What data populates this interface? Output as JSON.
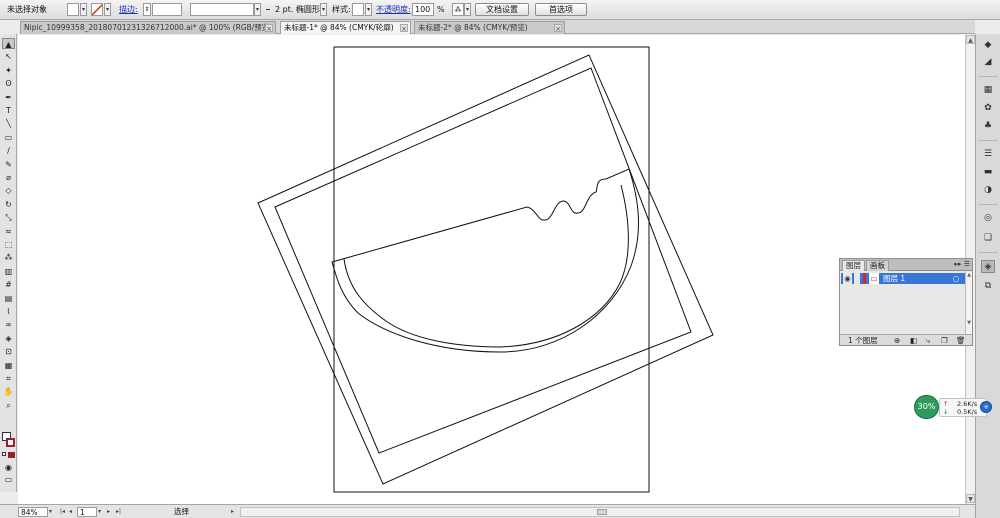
{
  "control_bar": {
    "selection_status": "未选择对象",
    "stroke_label": "描边:",
    "brush_label": "2 pt. 椭圆形",
    "style_label": "样式:",
    "opacity_label": "不透明度:",
    "opacity_value": "100",
    "opacity_unit": "%",
    "doc_setup_button": "文档设置",
    "preferences_button": "首选项"
  },
  "tabs": [
    {
      "label": "Nipic_10999358_20180701231326712000.ai* @ 100% (RGB/预览)",
      "active": false
    },
    {
      "label": "未标题-1* @ 84% (CMYK/轮廓)",
      "active": true
    },
    {
      "label": "未标题-2* @ 84% (CMYK/预览)",
      "active": false
    }
  ],
  "tools": [
    {
      "name": "selection-tool-icon",
      "glyph": "▲"
    },
    {
      "name": "direct-selection-tool-icon",
      "glyph": "↖"
    },
    {
      "name": "magic-wand-tool-icon",
      "glyph": "✦"
    },
    {
      "name": "lasso-tool-icon",
      "glyph": "ʘ"
    },
    {
      "name": "pen-tool-icon",
      "glyph": "✒"
    },
    {
      "name": "type-tool-icon",
      "glyph": "T"
    },
    {
      "name": "line-segment-tool-icon",
      "glyph": "╲"
    },
    {
      "name": "rectangle-tool-icon",
      "glyph": "▭"
    },
    {
      "name": "paintbrush-tool-icon",
      "glyph": "∕"
    },
    {
      "name": "pencil-tool-icon",
      "glyph": "✎"
    },
    {
      "name": "blob-brush-tool-icon",
      "glyph": "⌀"
    },
    {
      "name": "eraser-tool-icon",
      "glyph": "◇"
    },
    {
      "name": "rotate-tool-icon",
      "glyph": "↻"
    },
    {
      "name": "scale-tool-icon",
      "glyph": "⤡"
    },
    {
      "name": "warp-tool-icon",
      "glyph": "≈"
    },
    {
      "name": "free-transform-tool-icon",
      "glyph": "⬚"
    },
    {
      "name": "symbol-sprayer-tool-icon",
      "glyph": "⁂"
    },
    {
      "name": "column-graph-tool-icon",
      "glyph": "▥"
    },
    {
      "name": "mesh-tool-icon",
      "glyph": "#"
    },
    {
      "name": "gradient-tool-icon",
      "glyph": "▤"
    },
    {
      "name": "eyedropper-tool-icon",
      "glyph": "⌇"
    },
    {
      "name": "blend-tool-icon",
      "glyph": "∞"
    },
    {
      "name": "live-paint-bucket-tool-icon",
      "glyph": "◈"
    },
    {
      "name": "live-paint-selection-tool-icon",
      "glyph": "⊡"
    },
    {
      "name": "artboard-tool-icon",
      "glyph": "▦"
    },
    {
      "name": "slice-tool-icon",
      "glyph": "⌗"
    },
    {
      "name": "hand-tool-icon",
      "glyph": "✋"
    },
    {
      "name": "zoom-tool-icon",
      "glyph": "⌕"
    }
  ],
  "layers_panel": {
    "tab_layers": "图层",
    "tab_artboards": "画板",
    "layer_name": "图层 1",
    "layer_count": "1 个图层"
  },
  "network": {
    "percent": "30%",
    "upload": "2.6K/s",
    "download": "0.5K/s"
  },
  "status_bar": {
    "zoom": "84%",
    "artboard_number": "1",
    "current_tool": "选择"
  }
}
